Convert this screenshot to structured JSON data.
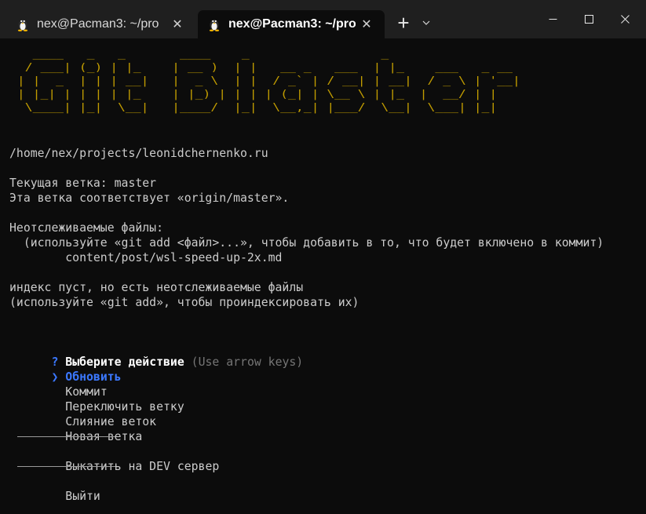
{
  "window": {
    "tabs": [
      {
        "title": "nex@Pacman3: ~/pro",
        "close": "✕"
      },
      {
        "title": "nex@Pacman3: ~/pro",
        "close": "✕"
      }
    ],
    "new_tab": "+",
    "tab_dropdown": "⌄",
    "controls": {
      "minimize": "minimize",
      "maximize": "maximize",
      "close": "close"
    }
  },
  "terminal": {
    "banner": [
      "   ____   _   _       ____    _                 _                ",
      "  / ___| (_) | |_    | __ )  | |   __ _   ___  | |_    ___   _ __ ",
      " | |  _  | | | __|   |  _ \\  | |  / _` | / __| | __|  / _ \\ | '__|",
      " | |_| | | | | |_    | |_) | | | | (_| | \\__ \\ | |_  |  __/ | |   ",
      "  \\____| |_|  \\__|   |____/  |_|  \\__,_| |___/  \\__|  \\___| |_|   "
    ],
    "banner_color": "#c19c00",
    "cwd": "/home/nex/projects/leonidchernenko.ru",
    "branch_line": "Текущая ветка: master",
    "up_to_date_line": "Эта ветка соответствует «origin/master».",
    "untracked_header": "Неотслеживаемые файлы:",
    "untracked_hint": "  (используйте «git add <файл>...», чтобы добавить в то, что будет включено в коммит)",
    "untracked_file": "        content/post/wsl-speed-up-2x.md",
    "index_empty_line": "индекс пуст, но есть неотслеживаемые файлы",
    "index_hint": "(используйте «git add», чтобы проиндексировать их)",
    "prompt": {
      "mark": "?",
      "question": "Выберите действие",
      "hint": "(Use arrow keys)",
      "pointer": "❯",
      "options": {
        "update": "Обновить",
        "commit": "Коммит",
        "switch_branch": "Переключить ветку",
        "merge": "Слияние веток",
        "new_branch": "Новая ветка",
        "deploy_dev": "Выкатить на DEV сервер",
        "exit": "Выйти"
      },
      "selected": "update",
      "accent_color": "#3b78ff"
    }
  }
}
